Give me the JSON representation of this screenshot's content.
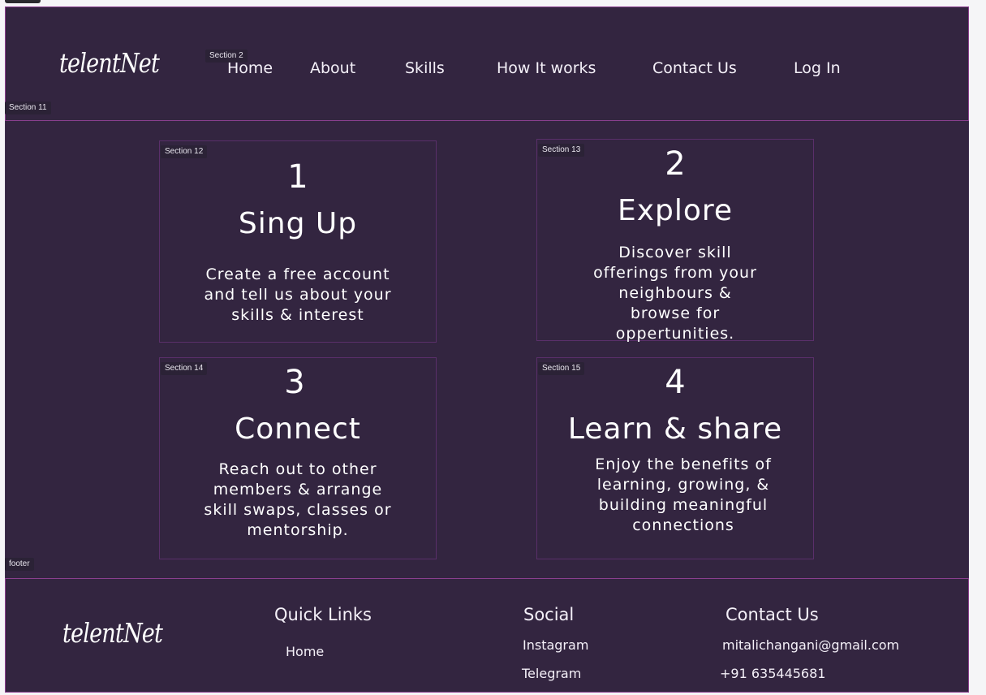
{
  "frame_labels": {
    "header_nav": "Section 2",
    "header": "Section 11",
    "card1": "Section 12",
    "card2": "Section 13",
    "card3": "Section 14",
    "card4": "Section 15",
    "footer": "footer"
  },
  "header": {
    "logo": "telentNet",
    "nav": [
      {
        "label": "Home"
      },
      {
        "label": "About"
      },
      {
        "label": "Skills"
      },
      {
        "label": "How It works"
      },
      {
        "label": "Contact Us"
      },
      {
        "label": "Log In"
      }
    ]
  },
  "steps": [
    {
      "number": "1",
      "title": "Sing Up",
      "desc": "Create a free account and tell us about your skills & interest"
    },
    {
      "number": "2",
      "title": "Explore",
      "desc": "Discover skill offerings from your neighbours & browse for oppertunities."
    },
    {
      "number": "3",
      "title": "Connect",
      "desc": "Reach out to other members & arrange skill swaps, classes or mentorship."
    },
    {
      "number": "4",
      "title": "Learn & share",
      "desc": "Enjoy the benefits of learning, growing, & building meaningful connections"
    }
  ],
  "footer": {
    "logo": "telentNet",
    "quick_links": {
      "heading": "Quick Links",
      "items": [
        "Home"
      ]
    },
    "social": {
      "heading": "Social",
      "items": [
        "Instagram",
        "Telegram"
      ]
    },
    "contact": {
      "heading": "Contact Us",
      "email": "mitalichangani@gmail.com",
      "phone": "+91 635445681"
    }
  },
  "colors": {
    "background": "#332540",
    "accent_border": "#8a3f8e",
    "text": "#ffffff"
  }
}
